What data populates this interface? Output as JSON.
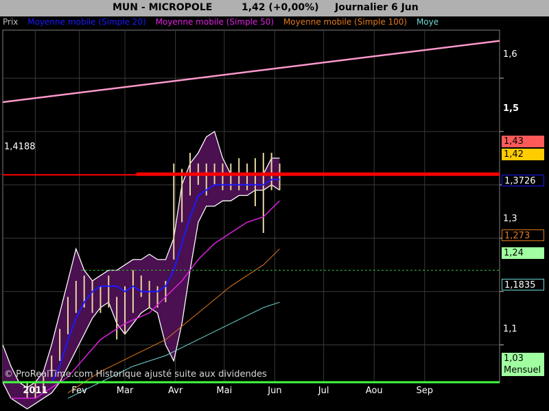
{
  "header": {
    "symbol": "MUN - MICROPOLE",
    "price_change": "1,42 (+0,00%)",
    "period": "Journalier  6 Jun"
  },
  "legend": [
    {
      "label": "Prix",
      "color": "#c0c0c0"
    },
    {
      "label": "Moyenne mobile (Simple 20)",
      "color": "#1a1aff"
    },
    {
      "label": "Moyenne mobile (Simple 50)",
      "color": "#e020e0"
    },
    {
      "label": "Moyenne mobile (Simple 100)",
      "color": "#e07a20"
    },
    {
      "label": "Moye",
      "color": "#6fd8d8"
    }
  ],
  "copyright": "© ProRealTime.com Historique ajusté suite aux dividendes",
  "level_label": "1,4188",
  "price_boxes": [
    {
      "id": "high",
      "text": "1,43",
      "bg": "#ff5a5a",
      "fg": "#000"
    },
    {
      "id": "last",
      "text": "1,42",
      "bg": "#ffcc00",
      "fg": "#000"
    },
    {
      "id": "ma20",
      "text": "1,3726",
      "bg": "#000",
      "fg": "#fff",
      "border": "#1a1aff"
    },
    {
      "id": "ma50",
      "text": "1,273",
      "bg": "#000",
      "fg": "#e07a20",
      "border": "#e07a20"
    },
    {
      "id": "dotted",
      "text": "1,24",
      "bg": "#a0ffa0",
      "fg": "#000"
    },
    {
      "id": "ma200",
      "text": "1,1835",
      "bg": "#000",
      "fg": "#fff",
      "border": "#6fd8d8"
    },
    {
      "id": "green",
      "text": "1,03",
      "bg": "#a0ffa0",
      "fg": "#000"
    },
    {
      "id": "green-sub",
      "text": "Mensuel",
      "bg": "#a0ffa0",
      "fg": "#000"
    }
  ],
  "chart_data": {
    "type": "line",
    "y_ticks": [
      1.1,
      1.2,
      1.3,
      1.4,
      1.5,
      1.6
    ],
    "y_tick_labels": [
      "1,1",
      "1,2",
      "1,3",
      "1,4",
      "1,5",
      "1,6"
    ],
    "ylim": [
      1.03,
      1.69
    ],
    "x_labels": [
      "2011",
      "Fev",
      "Mar",
      "Avr",
      "Mai",
      "Jun",
      "Jul",
      "Aou",
      "Sep"
    ],
    "x_label_days": [
      0,
      27,
      55,
      86,
      116,
      147,
      177,
      208,
      239
    ],
    "xlim": [
      -20,
      285
    ],
    "grid": true,
    "colors": {
      "band_fill": "#4a1050",
      "band_edge": "#ffffff",
      "price_bar": "#e8d8a0",
      "ma20": "#1a1aff",
      "ma50": "#e020e0",
      "ma100": "#e07a20",
      "ma200": "#6fd8d8",
      "trend_pink": "#ff99cc",
      "resistance": "#ff0000",
      "dotted": "#30c030",
      "support": "#40ff40"
    },
    "horizontal_lines": [
      {
        "name": "resistance_thick",
        "value": 1.42,
        "x_from": 62,
        "x_to": 285,
        "width": 5
      },
      {
        "name": "resistance_thin",
        "value": 1.4188,
        "x_from": -20,
        "x_to": 285,
        "width": 2
      },
      {
        "name": "dotted",
        "value": 1.24,
        "x_from": 28,
        "x_to": 285,
        "width": 1,
        "dash": true
      },
      {
        "name": "support",
        "value": 1.03,
        "x_from": -20,
        "x_to": 285,
        "width": 3
      }
    ],
    "trend_line": {
      "from": [
        -20,
        1.555
      ],
      "to": [
        285,
        1.67
      ]
    },
    "price_bars": {
      "days": [
        -5,
        0,
        5,
        10,
        15,
        20,
        25,
        30,
        35,
        40,
        45,
        50,
        55,
        60,
        65,
        70,
        75,
        80,
        85,
        90,
        95,
        100,
        105,
        110,
        115,
        120,
        125,
        130,
        135,
        140,
        145,
        150
      ],
      "high": [
        1.03,
        1.03,
        1.04,
        1.08,
        1.13,
        1.19,
        1.22,
        1.23,
        1.22,
        1.21,
        1.23,
        1.19,
        1.21,
        1.24,
        1.23,
        1.22,
        1.21,
        1.22,
        1.44,
        1.43,
        1.46,
        1.44,
        1.44,
        1.44,
        1.44,
        1.44,
        1.45,
        1.44,
        1.45,
        1.46,
        1.46,
        1.44
      ],
      "low": [
        1.0,
        1.0,
        1.01,
        1.04,
        1.07,
        1.12,
        1.16,
        1.17,
        1.16,
        1.16,
        1.17,
        1.11,
        1.12,
        1.16,
        1.19,
        1.17,
        1.17,
        1.18,
        1.26,
        1.33,
        1.38,
        1.4,
        1.38,
        1.4,
        1.39,
        1.39,
        1.39,
        1.39,
        1.36,
        1.31,
        1.39,
        1.39
      ]
    },
    "bands": {
      "days": [
        -20,
        -15,
        -10,
        -5,
        0,
        5,
        10,
        15,
        20,
        25,
        30,
        35,
        40,
        45,
        50,
        55,
        60,
        65,
        70,
        75,
        80,
        85,
        90,
        95,
        100,
        105,
        110,
        115,
        120,
        125,
        130,
        135,
        140,
        145,
        150
      ],
      "upper": [
        1.1,
        1.06,
        1.03,
        1.02,
        1.03,
        1.05,
        1.1,
        1.16,
        1.22,
        1.28,
        1.24,
        1.22,
        1.23,
        1.24,
        1.24,
        1.25,
        1.26,
        1.26,
        1.27,
        1.26,
        1.26,
        1.3,
        1.4,
        1.44,
        1.46,
        1.49,
        1.5,
        1.45,
        1.42,
        1.42,
        1.42,
        1.42,
        1.42,
        1.45,
        1.45
      ],
      "lower": [
        1.03,
        1.0,
        0.99,
        0.98,
        0.99,
        1.0,
        1.01,
        1.03,
        1.06,
        1.09,
        1.12,
        1.15,
        1.17,
        1.18,
        1.14,
        1.12,
        1.14,
        1.16,
        1.17,
        1.16,
        1.1,
        1.07,
        1.14,
        1.24,
        1.33,
        1.36,
        1.36,
        1.37,
        1.37,
        1.38,
        1.38,
        1.39,
        1.39,
        1.4,
        1.39
      ]
    },
    "series": [
      {
        "name": "Moyenne mobile (Simple 20)",
        "key": "ma20",
        "width": 2,
        "x": [
          10,
          15,
          20,
          25,
          30,
          35,
          40,
          45,
          50,
          55,
          60,
          65,
          70,
          75,
          80,
          85,
          90,
          95,
          100,
          105,
          110,
          115,
          120,
          125,
          130,
          135,
          140,
          145,
          150
        ],
        "y": [
          1.03,
          1.06,
          1.11,
          1.15,
          1.18,
          1.2,
          1.21,
          1.21,
          1.21,
          1.2,
          1.21,
          1.2,
          1.2,
          1.2,
          1.21,
          1.24,
          1.29,
          1.34,
          1.38,
          1.39,
          1.4,
          1.4,
          1.4,
          1.4,
          1.4,
          1.4,
          1.4,
          1.41,
          1.41
        ]
      },
      {
        "name": "Moyenne mobile (Simple 50)",
        "key": "ma50",
        "width": 1.5,
        "x": [
          -15,
          0,
          20,
          40,
          55,
          70,
          80,
          90,
          100,
          110,
          120,
          130,
          140,
          150
        ],
        "y": [
          1.0,
          1.0,
          1.04,
          1.11,
          1.14,
          1.16,
          1.19,
          1.22,
          1.26,
          1.29,
          1.31,
          1.33,
          1.34,
          1.37
        ]
      },
      {
        "name": "Moyenne mobile (Simple 100)",
        "key": "ma100",
        "width": 1,
        "x": [
          20,
          40,
          60,
          80,
          100,
          120,
          140,
          150
        ],
        "y": [
          1.01,
          1.05,
          1.08,
          1.11,
          1.16,
          1.21,
          1.25,
          1.28
        ]
      },
      {
        "name": "Moye",
        "key": "ma200",
        "width": 1,
        "x": [
          20,
          40,
          60,
          80,
          100,
          120,
          140,
          150
        ],
        "y": [
          1.0,
          1.03,
          1.06,
          1.08,
          1.11,
          1.14,
          1.17,
          1.18
        ]
      }
    ]
  }
}
